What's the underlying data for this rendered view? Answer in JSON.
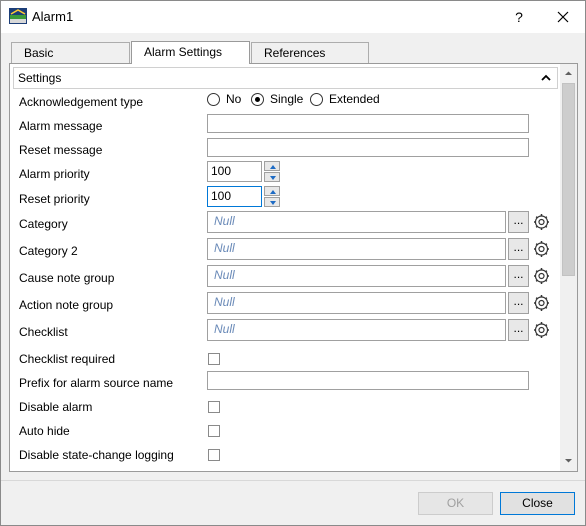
{
  "window": {
    "title": "Alarm1",
    "help_label": "?"
  },
  "tabs": [
    {
      "label": "Basic",
      "active": false
    },
    {
      "label": "Alarm Settings",
      "active": true
    },
    {
      "label": "References",
      "active": false
    }
  ],
  "section": {
    "title": "Settings"
  },
  "fields": {
    "ack_type": {
      "label": "Acknowledgement type",
      "options": [
        "No",
        "Single",
        "Extended"
      ],
      "selected": "Single"
    },
    "alarm_message": {
      "label": "Alarm message",
      "value": ""
    },
    "reset_message": {
      "label": "Reset message",
      "value": ""
    },
    "alarm_priority": {
      "label": "Alarm priority",
      "value": "100"
    },
    "reset_priority": {
      "label": "Reset priority",
      "value": "100"
    },
    "category": {
      "label": "Category",
      "value": "Null"
    },
    "category2": {
      "label": "Category 2",
      "value": "Null"
    },
    "cause_note_group": {
      "label": "Cause note group",
      "value": "Null"
    },
    "action_note_group": {
      "label": "Action note group",
      "value": "Null"
    },
    "checklist": {
      "label": "Checklist",
      "value": "Null"
    },
    "checklist_required": {
      "label": "Checklist required",
      "checked": false
    },
    "prefix_source": {
      "label": "Prefix for alarm source name",
      "value": ""
    },
    "disable_alarm": {
      "label": "Disable alarm",
      "checked": false
    },
    "auto_hide": {
      "label": "Auto hide",
      "checked": false
    },
    "disable_logging": {
      "label": "Disable state-change logging",
      "checked": false
    }
  },
  "ellipsis_label": "...",
  "buttons": {
    "ok": "OK",
    "close": "Close"
  },
  "icons": {
    "app": "alarm-app-icon",
    "gear": "gear-icon",
    "collapse": "chevron-up-icon"
  },
  "colors": {
    "accent": "#0078d7",
    "null_text": "#6a8ab8",
    "spin_arrow": "#1e6bc4"
  }
}
